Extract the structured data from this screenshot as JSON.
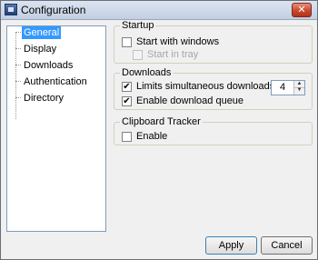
{
  "window": {
    "title": "Configuration",
    "close_glyph": "✕"
  },
  "tree": {
    "items": [
      {
        "label": "General",
        "selected": true
      },
      {
        "label": "Display"
      },
      {
        "label": "Downloads"
      },
      {
        "label": "Authentication"
      },
      {
        "label": "Directory"
      }
    ]
  },
  "startup": {
    "title": "Startup",
    "start_with_windows": {
      "label": "Start with windows",
      "checked": false
    },
    "start_in_tray": {
      "label": "Start in tray",
      "checked": false,
      "disabled": true
    }
  },
  "downloads": {
    "title": "Downloads",
    "limit": {
      "label": "Limits simultaneous downloads",
      "checked": true,
      "value": "4"
    },
    "queue": {
      "label": "Enable download queue",
      "checked": true
    }
  },
  "clipboard": {
    "title": "Clipboard Tracker",
    "enable": {
      "label": "Enable",
      "checked": false
    }
  },
  "buttons": {
    "apply": "Apply",
    "cancel": "Cancel"
  },
  "glyphs": {
    "check": "✔",
    "up": "▲",
    "down": "▼"
  }
}
